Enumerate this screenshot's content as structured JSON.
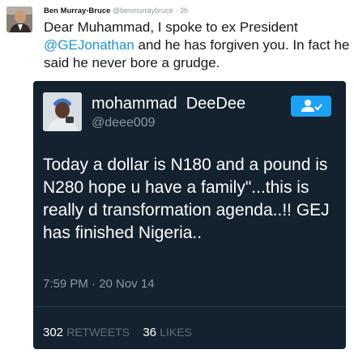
{
  "tweet": {
    "author_name": "Ben Murray-Bruce",
    "author_handle": "@benmurraybruce",
    "separator": "·",
    "time_ago": "3h",
    "text_part1": "Dear Muhammad, I spoke to ex President ",
    "mention": "@GEJonathan",
    "text_part2": " and he has forgiven you. In fact he said he never bore a grudge."
  },
  "embedded_tweet": {
    "author_name": "mohammad  DeeDee",
    "author_handle": "@deee009",
    "text": "Today a dollar is N180 and a pound is N280 hope u have a family\"...this is really d transformation agenda..!! GEJ has finished Nigeria..",
    "timestamp": "7:59 PM · 20 Nov 14",
    "retweets_count": "302",
    "retweets_label": "RETWEETS",
    "likes_count": "36",
    "likes_label": "LIKES"
  },
  "colors": {
    "mention": "#1b95e0",
    "embed_background": "#14212e",
    "follow_button": "#1da1f2",
    "muted_text": "#8899a6"
  },
  "icons": {
    "follow": "add-user-icon"
  }
}
